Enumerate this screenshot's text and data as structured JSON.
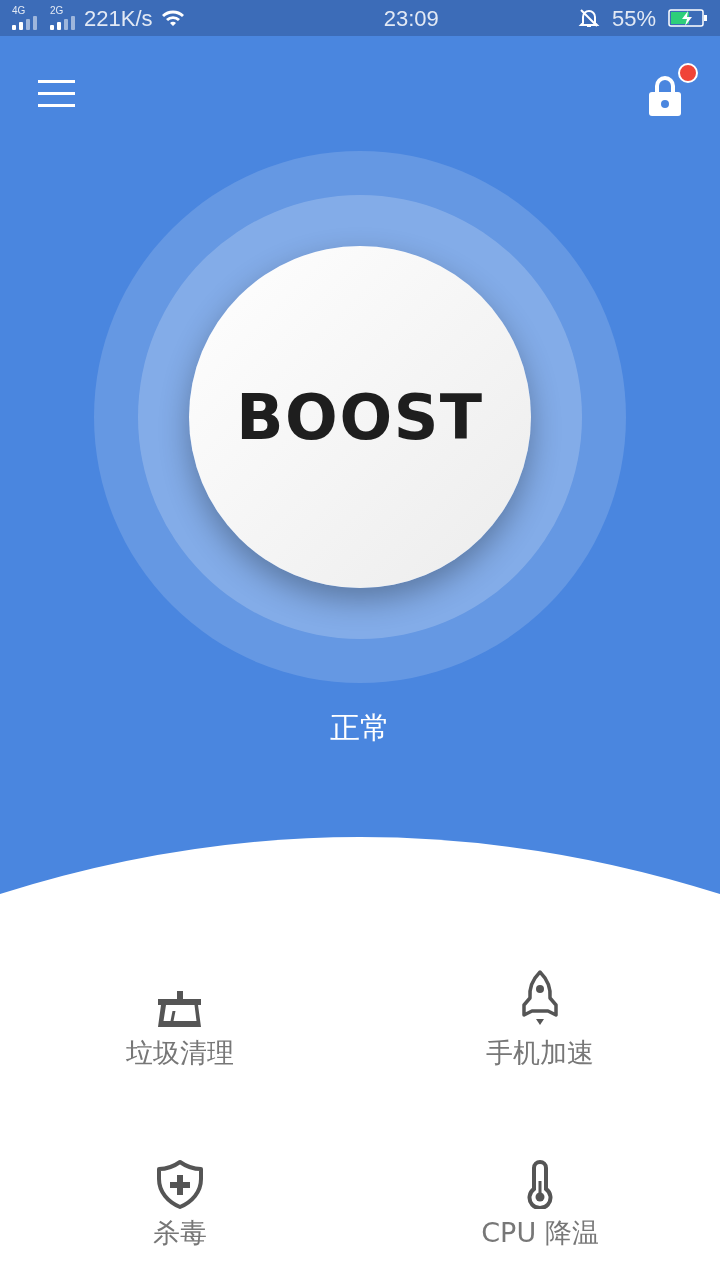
{
  "status_bar": {
    "sim_1": "4G",
    "sim_2": "2G",
    "speed": "221K/s",
    "time": "23:09",
    "battery": "55%",
    "charging": true
  },
  "header": {
    "lock_badge": true
  },
  "boost_button": {
    "label": "BOOST"
  },
  "status_text": "正常",
  "features": [
    {
      "kind": "broom",
      "label": "垃圾清理"
    },
    {
      "kind": "rocket",
      "label": "手机加速"
    },
    {
      "kind": "shield",
      "label": "杀毒"
    },
    {
      "kind": "thermometer",
      "label": "CPU 降温"
    }
  ]
}
